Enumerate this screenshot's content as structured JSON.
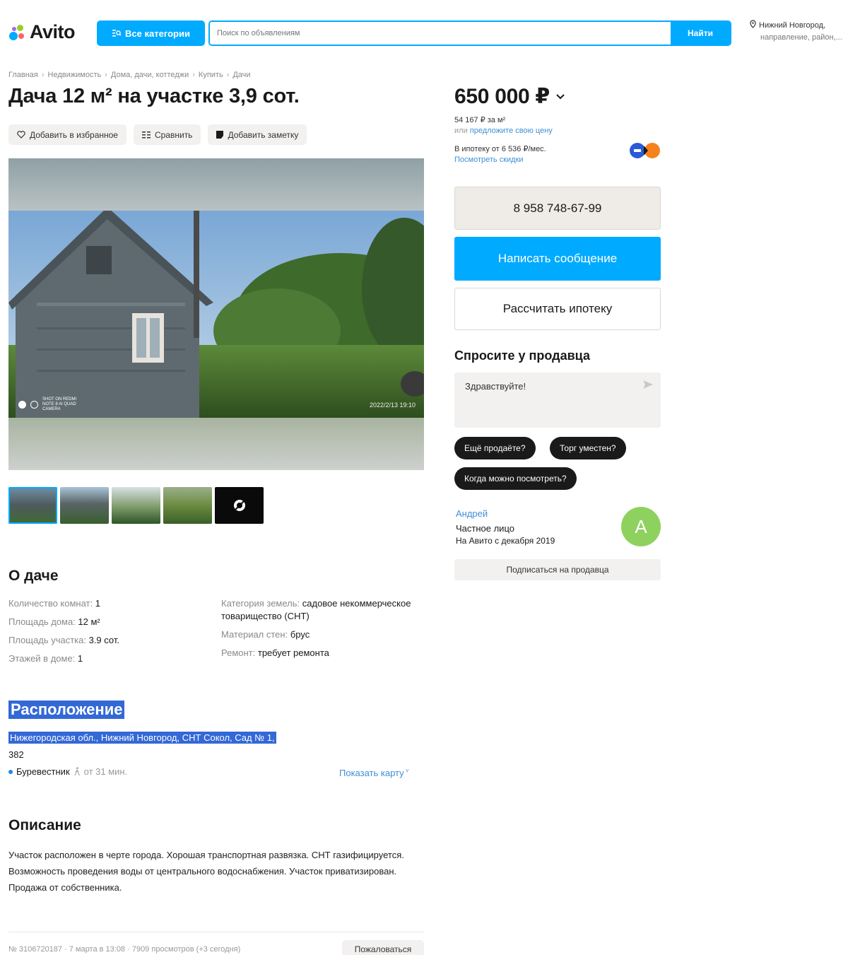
{
  "header": {
    "logo_text": "Avito",
    "categories_label": "Все категории",
    "search_placeholder": "Поиск по объявлениям",
    "search_button": "Найти",
    "location_city": "Нижний Новгород,",
    "location_sub": "направление, район,..."
  },
  "breadcrumbs": [
    "Главная",
    "Недвижимость",
    "Дома, дачи, коттеджи",
    "Купить",
    "Дачи"
  ],
  "title": "Дача 12 м² на участке 3,9 сот.",
  "actions": {
    "favorite": "Добавить в избранное",
    "compare": "Сравнить",
    "note": "Добавить заметку"
  },
  "gallery": {
    "photo_mark": "SHOT ON REDMI NOTE 8 AI QUAD CAMERA",
    "timestamp": "2022/2/13 19:10",
    "thumbnail_count": 5
  },
  "about": {
    "heading": "О даче",
    "left": [
      {
        "key": "Количество комнат: ",
        "value": "1"
      },
      {
        "key": "Площадь дома: ",
        "value": "12 м²"
      },
      {
        "key": "Площадь участка: ",
        "value": "3.9 сот."
      },
      {
        "key": "Этажей в доме: ",
        "value": "1"
      }
    ],
    "right": [
      {
        "key": "Категория земель: ",
        "value": "садовое некоммерческое товарищество (СНТ)"
      },
      {
        "key": "Материал стен: ",
        "value": "брус"
      },
      {
        "key": "Ремонт: ",
        "value": "требует ремонта"
      }
    ]
  },
  "location": {
    "heading": "Расположение",
    "address": "Нижегородская обл., Нижний Новгород, СНТ Сокол, Сад № 1,",
    "number": "382",
    "metro_name": "Буревестник",
    "metro_time": "от 31 мин.",
    "show_map": "Показать карту"
  },
  "description": {
    "heading": "Описание",
    "text": "Участок расположен в черте города. Хорошая транспортная развязка. СНТ газифицируется. Возможность проведения воды от центрального водоснабжения. Участок приватизирован. Продажа от собственника."
  },
  "footer": {
    "meta": "№ 3106720187 · 7 марта в 13:08 · 7909 просмотров (+3 сегодня)",
    "complain": "Пожаловаться"
  },
  "price": {
    "value": "650 000 ₽",
    "per_m2": "54 167 ₽ за м²",
    "offer_prefix": "или ",
    "offer_link": "предложите свою цену",
    "mortgage": "В ипотеку от 6 536 ₽/мес.",
    "discounts_link": "Посмотреть скидки"
  },
  "contact": {
    "phone": "8 958 748-67-99",
    "message_button": "Написать сообщение",
    "calc_button": "Рассчитать ипотеку"
  },
  "ask": {
    "heading": "Спросите у продавца",
    "input_value": "Здравствуйте!",
    "chips": [
      "Ещё продаёте?",
      "Торг уместен?",
      "Когда можно посмотреть?"
    ]
  },
  "seller": {
    "name": "Андрей",
    "type": "Частное лицо",
    "since": "На Авито с декабря 2019",
    "avatar_letter": "А",
    "subscribe": "Подписаться на продавца"
  },
  "colors": {
    "accent": "#00aaff",
    "link": "#3d8fd6",
    "avatar": "#8fd15e",
    "highlight": "#3368d6"
  }
}
